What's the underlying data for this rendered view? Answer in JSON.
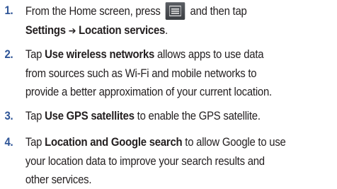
{
  "steps": [
    {
      "number": "1.",
      "lines": [
        {
          "before": "From the Home screen, press",
          "icon": "menu-key-icon",
          "after": "and then tap"
        },
        {
          "settings": "Settings",
          "arrow": "➔",
          "location": "Location services",
          "tail": "."
        }
      ]
    },
    {
      "number": "2.",
      "lines": [
        {
          "pre": "Tap ",
          "bold": "Use wireless networks",
          "post": " allows apps to use data"
        },
        {
          "text": "from sources such as Wi-Fi and mobile networks to"
        },
        {
          "text": "provide a better approximation of your current location."
        }
      ]
    },
    {
      "number": "3.",
      "lines": [
        {
          "pre": "Tap ",
          "bold": "Use GPS satellites",
          "post": " to enable the GPS satellite."
        }
      ]
    },
    {
      "number": "4.",
      "lines": [
        {
          "pre": "Tap ",
          "bold": "Location and Google search",
          "post": " to allow Google to use"
        },
        {
          "text": "your location data to improve your search results and"
        },
        {
          "text": "other services."
        }
      ]
    }
  ],
  "colors": {
    "step_number": "#2f5597",
    "body_text": "#231f20",
    "menu_key_bg": "#4a4e53",
    "menu_key_glyph": "#e8e8e8"
  }
}
